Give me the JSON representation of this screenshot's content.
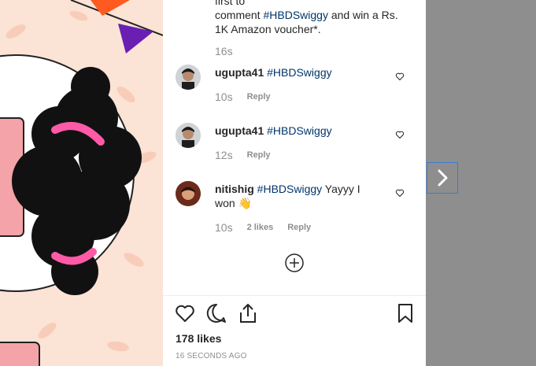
{
  "comments_top": {
    "text_line1": "first to",
    "text_prefix": "comment ",
    "hashtag": "#HBDSwiggy",
    "text_suffix": " and win a Rs. 1K Amazon voucher*.",
    "time": "16s"
  },
  "comments": [
    {
      "username": "ugupta41",
      "hashtag": "#HBDSwiggy",
      "extra": "",
      "time": "10s",
      "likes": "",
      "reply": "Reply"
    },
    {
      "username": "ugupta41",
      "hashtag": "#HBDSwiggy",
      "extra": "",
      "time": "12s",
      "likes": "",
      "reply": "Reply"
    },
    {
      "username": "nitishig",
      "hashtag": "#HBDSwiggy",
      "extra": " Yayyy I won 👋",
      "time": "10s",
      "likes": "2 likes",
      "reply": "Reply"
    }
  ],
  "post": {
    "likes": "178 likes",
    "timestamp": "16 SECONDS AGO"
  },
  "icons": {
    "like": "heart-icon",
    "comment": "comment-icon",
    "share": "share-icon",
    "save": "bookmark-icon",
    "load_more": "plus-circle-icon",
    "next": "chevron-right-icon"
  }
}
